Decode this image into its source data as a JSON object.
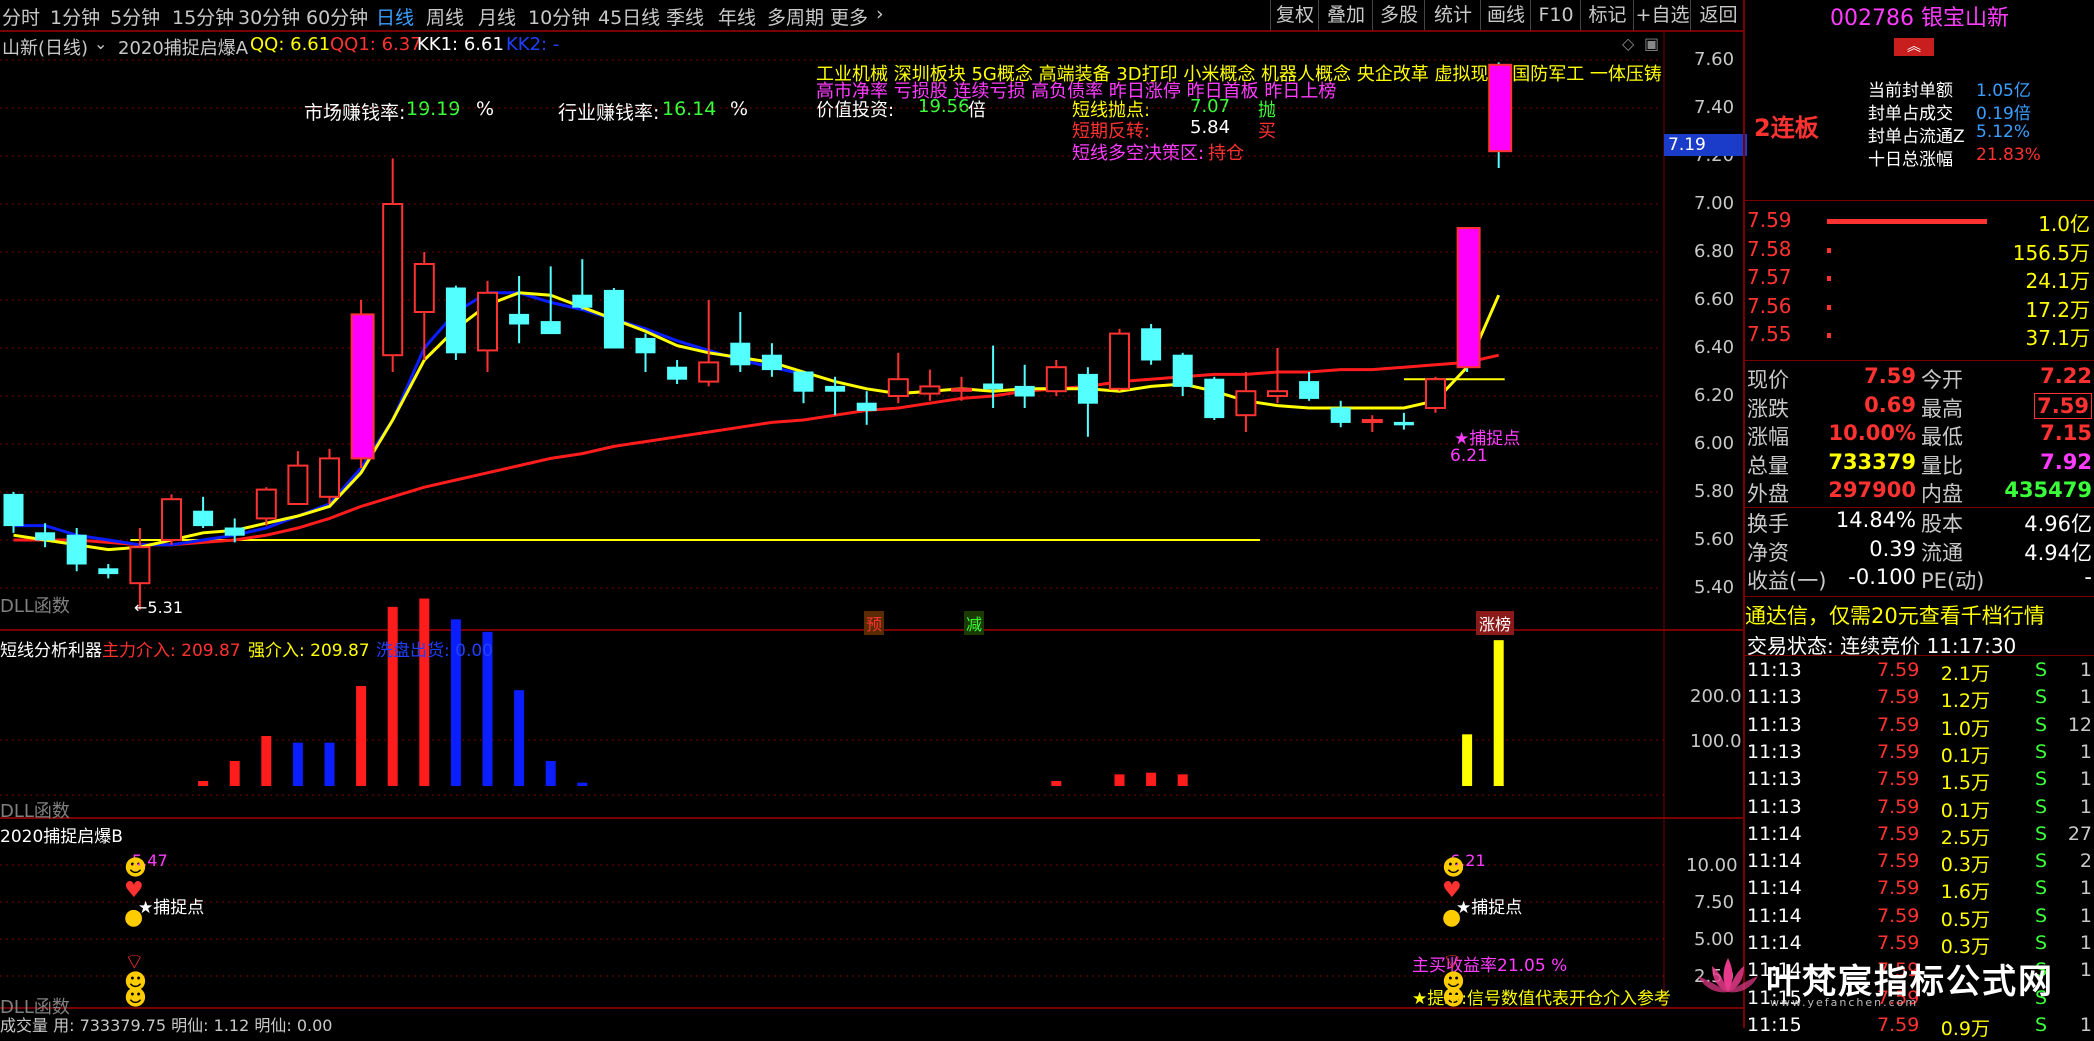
{
  "toolbar": {
    "periods": [
      "分时",
      "1分钟",
      "5分钟",
      "15分钟",
      "30分钟",
      "60分钟",
      "日线",
      "周线",
      "月线",
      "10分钟",
      "45日线",
      "季线",
      "年线",
      "多周期",
      "更多"
    ],
    "active_period": "日线",
    "tools": [
      "复权",
      "叠加",
      "多股",
      "统计",
      "画线",
      "F10",
      "标记",
      "+自选",
      "返回"
    ]
  },
  "chart_header": {
    "name": "山新(日线)",
    "formula": "2020捕捉启爆A",
    "qq": "QQ: 6.61",
    "qq1": "QQ1: 6.37",
    "kk1": "KK1: 6.61",
    "kk2": "KK2: -"
  },
  "rates": {
    "market_label": "市场赚钱率:",
    "market_value": "19.19",
    "market_unit": "%",
    "industry_label": "行业赚钱率:",
    "industry_value": "16.14",
    "industry_unit": "%"
  },
  "concepts": {
    "line1": "工业机械  深圳板块  5G概念 高端装备 3D打印 小米概念 机器人概念 央企改革 虚拟现实 国防军工 一体压铸",
    "line2": "高市净率 亏损股 连续亏损 高负债率 昨日涨停 昨日首板 昨日上榜",
    "value_label": "价值投资:",
    "value_num": "19.56",
    "value_unit": "倍"
  },
  "short_signals": {
    "sell_label": "短线抛点:",
    "sell_value": "7.07",
    "sell_action": "抛",
    "rev_label": "短期反转:",
    "rev_value": "5.84",
    "rev_action": "买",
    "zone_label": "短线多空决策区:",
    "zone_value": "持仓"
  },
  "yaxis_main": [
    "7.60",
    "7.40",
    "7.20",
    "7.00",
    "6.80",
    "6.60",
    "6.40",
    "6.20",
    "6.00",
    "5.80",
    "5.60",
    "5.40"
  ],
  "current_price_tag": "7.19",
  "main_labels": {
    "dll": "DLL函数",
    "low_tag": "5.31",
    "catch_point": "★捕捉点",
    "catch_value": "6.21",
    "pre": "预",
    "reduce": "减",
    "limit_list": "涨榜"
  },
  "sub1": {
    "title": "短线分析利器",
    "main_in": "主力介入: 209.87",
    "strong_in": "强介入: 209.87",
    "wash_out": "洗盘出货: 0.00",
    "dll": "DLL函数",
    "yaxis": [
      "200.0",
      "100.0"
    ]
  },
  "sub2": {
    "title": "2020捕捉启爆B",
    "left_value": "5.47",
    "left_catch": "★捕捉点",
    "right_value": "6.21",
    "right_catch": "★捕捉点",
    "yield_text": "主买收益率21.05 %",
    "hint_text": "★提示:信号数值代表开仓介入参考",
    "dll": "DLL函数",
    "yaxis": [
      "10.00",
      "7.50",
      "5.00",
      "2.50"
    ]
  },
  "status_bar": {
    "text": "成交量  用: 733379.75  明仙: 1.12  明仙: 0.00"
  },
  "right_panel": {
    "code": "002786",
    "name": "银宝山新",
    "streak": "2连板",
    "seal_stats": [
      {
        "label": "当前封单额",
        "value": "1.05亿"
      },
      {
        "label": "封单占成交",
        "value": "0.19倍"
      },
      {
        "label": "封单占流通Z",
        "value": "5.12%"
      },
      {
        "label": "十日总涨幅",
        "value": "21.83%"
      }
    ],
    "order_book": [
      {
        "price": "7.59",
        "vol": "1.0亿"
      },
      {
        "price": "7.58",
        "vol": "156.5万"
      },
      {
        "price": "7.57",
        "vol": "24.1万"
      },
      {
        "price": "7.56",
        "vol": "17.2万"
      },
      {
        "price": "7.55",
        "vol": "37.1万"
      }
    ],
    "quote": [
      {
        "l1": "现价",
        "v1": "7.59",
        "l2": "今开",
        "v2": "7.22"
      },
      {
        "l1": "涨跌",
        "v1": "0.69",
        "l2": "最高",
        "v2": "7.59"
      },
      {
        "l1": "涨幅",
        "v1": "10.00%",
        "l2": "最低",
        "v2": "7.15"
      },
      {
        "l1": "总量",
        "v1": "733379",
        "l2": "量比",
        "v2": "7.92"
      },
      {
        "l1": "外盘",
        "v1": "297900",
        "l2": "内盘",
        "v2": "435479"
      }
    ],
    "fund": [
      {
        "l1": "换手",
        "v1": "14.84%",
        "l2": "股本",
        "v2": "4.96亿"
      },
      {
        "l1": "净资",
        "v1": "0.39",
        "l2": "流通",
        "v2": "4.94亿"
      },
      {
        "l1": "收益(一)",
        "v1": "-0.100",
        "l2": "PE(动)",
        "v2": "-"
      }
    ],
    "ad": "通达信，仅需20元查看千档行情",
    "trade_state": "交易状态: 连续竞价 11:17:30",
    "ticks": [
      {
        "t": "11:13",
        "p": "7.59",
        "v": "2.1万",
        "s": "S",
        "n": "1"
      },
      {
        "t": "11:13",
        "p": "7.59",
        "v": "1.2万",
        "s": "S",
        "n": "1"
      },
      {
        "t": "11:13",
        "p": "7.59",
        "v": "1.0万",
        "s": "S",
        "n": "12"
      },
      {
        "t": "11:13",
        "p": "7.59",
        "v": "0.1万",
        "s": "S",
        "n": "1"
      },
      {
        "t": "11:13",
        "p": "7.59",
        "v": "1.5万",
        "s": "S",
        "n": "1"
      },
      {
        "t": "11:13",
        "p": "7.59",
        "v": "0.1万",
        "s": "S",
        "n": "1"
      },
      {
        "t": "11:14",
        "p": "7.59",
        "v": "2.5万",
        "s": "S",
        "n": "27"
      },
      {
        "t": "11:14",
        "p": "7.59",
        "v": "0.3万",
        "s": "S",
        "n": "2"
      },
      {
        "t": "11:14",
        "p": "7.59",
        "v": "1.6万",
        "s": "S",
        "n": "1"
      },
      {
        "t": "11:14",
        "p": "7.59",
        "v": "0.5万",
        "s": "S",
        "n": "1"
      },
      {
        "t": "11:14",
        "p": "7.59",
        "v": "0.3万",
        "s": "S",
        "n": "1"
      },
      {
        "t": "11:14",
        "p": "7.59",
        "v": "",
        "s": "S",
        "n": "1"
      },
      {
        "t": "11:15",
        "p": "7.59",
        "v": "",
        "s": "S",
        "n": ""
      },
      {
        "t": "11:15",
        "p": "7.59",
        "v": "0.9万",
        "s": "S",
        "n": "1"
      }
    ]
  },
  "watermark": {
    "title": "叶梵宸指标公式网",
    "url": "www.yefanchen.com"
  },
  "chart_data": {
    "type": "candlestick",
    "ylim": [
      5.3,
      7.65
    ],
    "candles": [
      {
        "o": 5.79,
        "h": 5.8,
        "l": 5.63,
        "c": 5.66
      },
      {
        "o": 5.63,
        "h": 5.67,
        "l": 5.57,
        "c": 5.6
      },
      {
        "o": 5.62,
        "h": 5.65,
        "l": 5.47,
        "c": 5.5
      },
      {
        "o": 5.48,
        "h": 5.5,
        "l": 5.44,
        "c": 5.46
      },
      {
        "o": 5.42,
        "h": 5.65,
        "l": 5.31,
        "c": 5.57
      },
      {
        "o": 5.6,
        "h": 5.79,
        "l": 5.58,
        "c": 5.77
      },
      {
        "o": 5.72,
        "h": 5.78,
        "l": 5.65,
        "c": 5.66
      },
      {
        "o": 5.65,
        "h": 5.69,
        "l": 5.59,
        "c": 5.62
      },
      {
        "o": 5.69,
        "h": 5.82,
        "l": 5.66,
        "c": 5.81
      },
      {
        "o": 5.75,
        "h": 5.97,
        "l": 5.75,
        "c": 5.91
      },
      {
        "o": 5.78,
        "h": 5.98,
        "l": 5.75,
        "c": 5.94
      },
      {
        "o": 5.94,
        "h": 6.6,
        "l": 5.9,
        "c": 6.54
      },
      {
        "o": 6.37,
        "h": 7.19,
        "l": 6.3,
        "c": 7.0
      },
      {
        "o": 6.55,
        "h": 6.8,
        "l": 6.35,
        "c": 6.75
      },
      {
        "o": 6.65,
        "h": 6.66,
        "l": 6.35,
        "c": 6.38
      },
      {
        "o": 6.39,
        "h": 6.68,
        "l": 6.3,
        "c": 6.63
      },
      {
        "o": 6.54,
        "h": 6.7,
        "l": 6.42,
        "c": 6.5
      },
      {
        "o": 6.51,
        "h": 6.74,
        "l": 6.48,
        "c": 6.46
      },
      {
        "o": 6.62,
        "h": 6.77,
        "l": 6.56,
        "c": 6.57
      },
      {
        "o": 6.64,
        "h": 6.65,
        "l": 6.4,
        "c": 6.4
      },
      {
        "o": 6.44,
        "h": 6.46,
        "l": 6.3,
        "c": 6.38
      },
      {
        "o": 6.32,
        "h": 6.35,
        "l": 6.25,
        "c": 6.27
      },
      {
        "o": 6.26,
        "h": 6.6,
        "l": 6.24,
        "c": 6.34
      },
      {
        "o": 6.42,
        "h": 6.55,
        "l": 6.3,
        "c": 6.33
      },
      {
        "o": 6.37,
        "h": 6.42,
        "l": 6.28,
        "c": 6.31
      },
      {
        "o": 6.3,
        "h": 6.3,
        "l": 6.17,
        "c": 6.22
      },
      {
        "o": 6.24,
        "h": 6.28,
        "l": 6.12,
        "c": 6.22
      },
      {
        "o": 6.17,
        "h": 6.22,
        "l": 6.08,
        "c": 6.14
      },
      {
        "o": 6.2,
        "h": 6.38,
        "l": 6.17,
        "c": 6.27
      },
      {
        "o": 6.21,
        "h": 6.31,
        "l": 6.18,
        "c": 6.24
      },
      {
        "o": 6.23,
        "h": 6.28,
        "l": 6.18,
        "c": 6.23
      },
      {
        "o": 6.25,
        "h": 6.41,
        "l": 6.15,
        "c": 6.23
      },
      {
        "o": 6.24,
        "h": 6.33,
        "l": 6.15,
        "c": 6.2
      },
      {
        "o": 6.22,
        "h": 6.35,
        "l": 6.2,
        "c": 6.32
      },
      {
        "o": 6.29,
        "h": 6.32,
        "l": 6.03,
        "c": 6.17
      },
      {
        "o": 6.23,
        "h": 6.48,
        "l": 6.22,
        "c": 6.46
      },
      {
        "o": 6.48,
        "h": 6.5,
        "l": 6.33,
        "c": 6.35
      },
      {
        "o": 6.37,
        "h": 6.38,
        "l": 6.2,
        "c": 6.24
      },
      {
        "o": 6.27,
        "h": 6.28,
        "l": 6.1,
        "c": 6.11
      },
      {
        "o": 6.12,
        "h": 6.3,
        "l": 6.05,
        "c": 6.22
      },
      {
        "o": 6.2,
        "h": 6.4,
        "l": 6.17,
        "c": 6.22
      },
      {
        "o": 6.26,
        "h": 6.3,
        "l": 6.18,
        "c": 6.19
      },
      {
        "o": 6.15,
        "h": 6.18,
        "l": 6.07,
        "c": 6.09
      },
      {
        "o": 6.1,
        "h": 6.12,
        "l": 6.05,
        "c": 6.1
      },
      {
        "o": 6.09,
        "h": 6.13,
        "l": 6.06,
        "c": 6.08
      },
      {
        "o": 6.15,
        "h": 6.28,
        "l": 6.13,
        "c": 6.27
      },
      {
        "o": 6.9,
        "h": 6.9,
        "l": 6.3,
        "c": 6.32
      },
      {
        "o": 7.58,
        "h": 7.59,
        "l": 7.15,
        "c": 7.22
      }
    ],
    "limit_up_idx": [
      11,
      46,
      47
    ],
    "ma_short": [
      5.62,
      5.6,
      5.58,
      5.56,
      5.57,
      5.6,
      5.63,
      5.64,
      5.67,
      5.7,
      5.74,
      5.88,
      6.1,
      6.35,
      6.48,
      6.58,
      6.63,
      6.62,
      6.57,
      6.52,
      6.47,
      6.41,
      6.38,
      6.36,
      6.34,
      6.3,
      6.26,
      6.23,
      6.21,
      6.22,
      6.23,
      6.22,
      6.23,
      6.23,
      6.23,
      6.22,
      6.24,
      6.25,
      6.22,
      6.18,
      6.16,
      6.15,
      6.15,
      6.15,
      6.15,
      6.18,
      6.32,
      6.62
    ],
    "ma_blue_range": [
      0,
      25
    ],
    "ma_blue": [
      5.66,
      5.66,
      5.62,
      5.6,
      5.58,
      5.58,
      5.6,
      5.62,
      5.65,
      5.7,
      5.75,
      5.9,
      6.1,
      6.4,
      6.55,
      6.63,
      6.63,
      6.59,
      6.56,
      6.52,
      6.48,
      6.43,
      6.39,
      6.35,
      6.32,
      6.29
    ],
    "ma_long": [
      5.6,
      5.6,
      5.6,
      5.59,
      5.58,
      5.58,
      5.59,
      5.6,
      5.62,
      5.65,
      5.69,
      5.74,
      5.78,
      5.82,
      5.85,
      5.88,
      5.91,
      5.94,
      5.96,
      5.99,
      6.01,
      6.03,
      6.05,
      6.07,
      6.09,
      6.1,
      6.12,
      6.14,
      6.15,
      6.17,
      6.19,
      6.2,
      6.22,
      6.23,
      6.24,
      6.26,
      6.27,
      6.28,
      6.29,
      6.29,
      6.3,
      6.3,
      6.31,
      6.31,
      6.32,
      6.33,
      6.34,
      6.37
    ],
    "support_level": 5.6,
    "resist_level": 6.27,
    "sub_bars": [
      {
        "i": 6,
        "v": 6,
        "color": "red"
      },
      {
        "i": 7,
        "v": 30,
        "color": "red"
      },
      {
        "i": 8,
        "v": 60,
        "color": "red"
      },
      {
        "i": 9,
        "v": 52,
        "color": "blue"
      },
      {
        "i": 10,
        "v": 52,
        "color": "blue"
      },
      {
        "i": 11,
        "v": 120,
        "color": "red"
      },
      {
        "i": 12,
        "v": 215,
        "color": "red"
      },
      {
        "i": 13,
        "v": 225,
        "color": "red"
      },
      {
        "i": 14,
        "v": 200,
        "color": "blue"
      },
      {
        "i": 15,
        "v": 185,
        "color": "blue"
      },
      {
        "i": 16,
        "v": 115,
        "color": "blue"
      },
      {
        "i": 17,
        "v": 30,
        "color": "blue"
      },
      {
        "i": 18,
        "v": 4,
        "color": "blue"
      },
      {
        "i": 33,
        "v": 6,
        "color": "red"
      },
      {
        "i": 35,
        "v": 14,
        "color": "red"
      },
      {
        "i": 36,
        "v": 16,
        "color": "red"
      },
      {
        "i": 37,
        "v": 14,
        "color": "red"
      },
      {
        "i": 46,
        "v": 62,
        "color": "yellow"
      },
      {
        "i": 47,
        "v": 175,
        "color": "yellow"
      }
    ],
    "sub_ylim": [
      0,
      240
    ]
  },
  "colors": {
    "up": "#ff3232",
    "down": "#54ffff",
    "limit": "#ff00ff",
    "ma_short": "#ffff00",
    "ma_blue": "#0a1eff",
    "ma_long": "#ff1c1c",
    "grid": "#7a0000"
  }
}
